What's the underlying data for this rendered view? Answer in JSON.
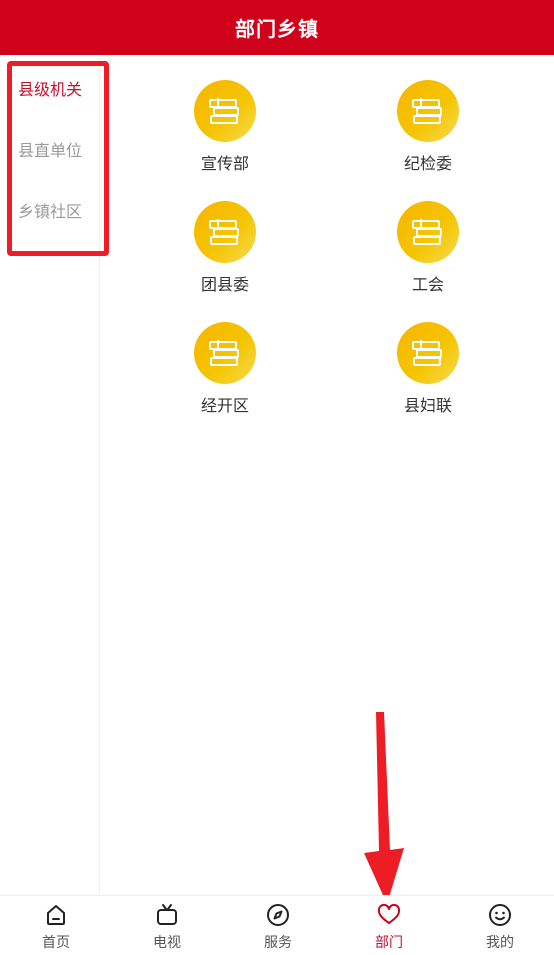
{
  "header": {
    "title": "部门乡镇"
  },
  "sidebar": {
    "items": [
      {
        "label": "县级机关",
        "active": true
      },
      {
        "label": "县直单位",
        "active": false
      },
      {
        "label": "乡镇社区",
        "active": false
      }
    ]
  },
  "grid": {
    "items": [
      {
        "label": "宣传部",
        "icon": "books-icon"
      },
      {
        "label": "纪检委",
        "icon": "books-icon"
      },
      {
        "label": "团县委",
        "icon": "books-icon"
      },
      {
        "label": "工会",
        "icon": "books-icon"
      },
      {
        "label": "经开区",
        "icon": "books-icon"
      },
      {
        "label": "县妇联",
        "icon": "books-icon"
      }
    ]
  },
  "tabbar": {
    "items": [
      {
        "label": "首页",
        "icon": "home-icon",
        "active": false
      },
      {
        "label": "电视",
        "icon": "tv-icon",
        "active": false
      },
      {
        "label": "服务",
        "icon": "compass-icon",
        "active": false
      },
      {
        "label": "部门",
        "icon": "heart-icon",
        "active": true
      },
      {
        "label": "我的",
        "icon": "smiley-icon",
        "active": false
      }
    ]
  },
  "colors": {
    "brand": "#d0021b",
    "active_text": "#c8102e",
    "inactive_text": "#9a9a9a",
    "icon_gold": "#f5c400",
    "annotation_red": "#ee1c25"
  }
}
